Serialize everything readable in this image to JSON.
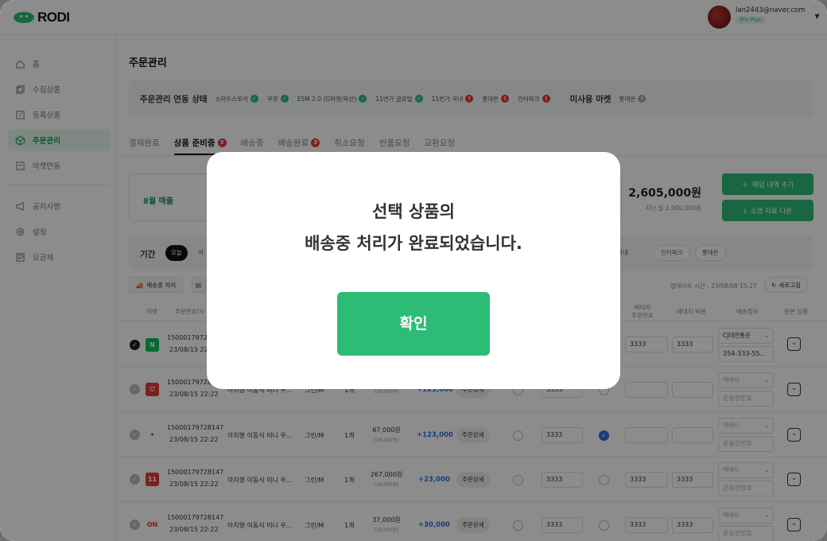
{
  "app": {
    "logo_text": "RODI"
  },
  "user": {
    "email": "lan2443@naver.com",
    "plan": "Pro Plan"
  },
  "sidebar": {
    "items": [
      {
        "label": "홈",
        "icon": "home-icon"
      },
      {
        "label": "수집상품",
        "icon": "collect-icon"
      },
      {
        "label": "등록상품",
        "icon": "edit-icon"
      },
      {
        "label": "주문관리",
        "icon": "box-icon",
        "active": true
      },
      {
        "label": "마켓연동",
        "icon": "market-icon"
      },
      {
        "label": "공지사항",
        "icon": "megaphone-icon"
      },
      {
        "label": "설정",
        "icon": "gear-icon"
      },
      {
        "label": "요금제",
        "icon": "pricing-icon"
      }
    ]
  },
  "page": {
    "title": "주문관리"
  },
  "status_bar": {
    "title": "주문관리 연동 상태",
    "channels": [
      {
        "name": "스마트스토어",
        "state": "ok"
      },
      {
        "name": "쿠팡",
        "state": "ok"
      },
      {
        "name": "ESM 2.0 (G마켓/옥션)",
        "state": "ok"
      },
      {
        "name": "11번가 글로벌",
        "state": "ok"
      },
      {
        "name": "11번가 국내",
        "state": "error"
      },
      {
        "name": "롯데온",
        "state": "error"
      },
      {
        "name": "인터파크",
        "state": "error"
      }
    ],
    "unused_title": "미사용 마켓",
    "unused": [
      {
        "name": "롯데온"
      }
    ]
  },
  "tabs": [
    {
      "label": "결제완료"
    },
    {
      "label": "상품 준비중",
      "count": "3",
      "active": true
    },
    {
      "label": "배송중"
    },
    {
      "label": "배송완료",
      "count": "3"
    },
    {
      "label": "취소요청"
    },
    {
      "label": "반품요청"
    },
    {
      "label": "교환요청"
    }
  ],
  "summary": {
    "label": "8월 매출",
    "amount": "2,605,000원",
    "sub": "지난 달 1,000,000원",
    "add_button": "매입 내역 추가",
    "download_button": "소명 자료 다운"
  },
  "filter": {
    "label": "기간",
    "today": "오늘",
    "partial": "어",
    "market_pills": [
      "국내",
      "인터파크",
      "롯데온"
    ]
  },
  "actions": {
    "ship_button": "배송중 처리",
    "update_time": "업데이트 시간 : 23/08/08 15:27",
    "refresh_button": "새로고침"
  },
  "table": {
    "headers": {
      "market": "마켓",
      "order": "주문번호/시",
      "purchase_order": "배대지\n주문번호",
      "purchase_cost": "배대지 비용",
      "ship_info": "배송정보",
      "origin": "원본 상품"
    },
    "rows": [
      {
        "order_no": "15000179728",
        "date": "23/08/15 22",
        "market": "N",
        "market_color": "#03c75a",
        "checked": true,
        "po": "3333",
        "cost": "3333",
        "carrier": "CJ대한통운",
        "tracking": "354-333-55..."
      },
      {
        "order_no": "15000179728147",
        "date": "23/08/15 22:22",
        "name": "아치형 이동식 미니 우...",
        "option": "그린/M",
        "qty": "1개",
        "price": "",
        "sub_price": "(18,000원)",
        "plus": "+123,000",
        "detail": "주문상세",
        "po_left": "3333",
        "market_color": "#e53935",
        "carrier_ph": "택배사",
        "tracking_ph": "운송장번호"
      },
      {
        "order_no": "15000179728147",
        "date": "23/08/15 22:22",
        "name": "아치형 이동식 미니 우...",
        "option": "그린/M",
        "qty": "1개",
        "price": "67,000원",
        "sub_price": "(18,000원)",
        "plus": "+123,000",
        "detail": "주문상세",
        "po_left": "3333",
        "market_color": "#ffffff",
        "carrier_ph": "택배사",
        "tracking_ph": "운송장번호",
        "radio_on": true
      },
      {
        "order_no": "15000179728147",
        "date": "23/08/15 22:22",
        "name": "아치형 이동식 미니 우...",
        "option": "그린/M",
        "qty": "1개",
        "price": "267,000원",
        "sub_price": "(18,000원)",
        "plus": "+23,000",
        "detail": "주문상세",
        "po_left": "3333",
        "po": "3333",
        "cost": "3333",
        "market": "11",
        "market_color": "#e53935",
        "carrier_ph": "택배사",
        "tracking_ph": "운송장번호"
      },
      {
        "order_no": "15000179728147",
        "date": "23/08/15 22:22",
        "name": "아치형 이동식 미니 우...",
        "option": "그린/M",
        "qty": "1개",
        "price": "37,000원",
        "sub_price": "(18,000원)",
        "plus": "+30,000",
        "detail": "주문상세",
        "po_left": "3333",
        "po": "3333",
        "cost": "3333",
        "market": "ON",
        "market_color": "#ffffff",
        "carrier_ph": "택배사",
        "tracking_ph": "운송장번호"
      }
    ]
  },
  "modal": {
    "line1": "선택 상품의",
    "line2": "배송중 처리가 완료되었습니다.",
    "confirm": "확인"
  }
}
